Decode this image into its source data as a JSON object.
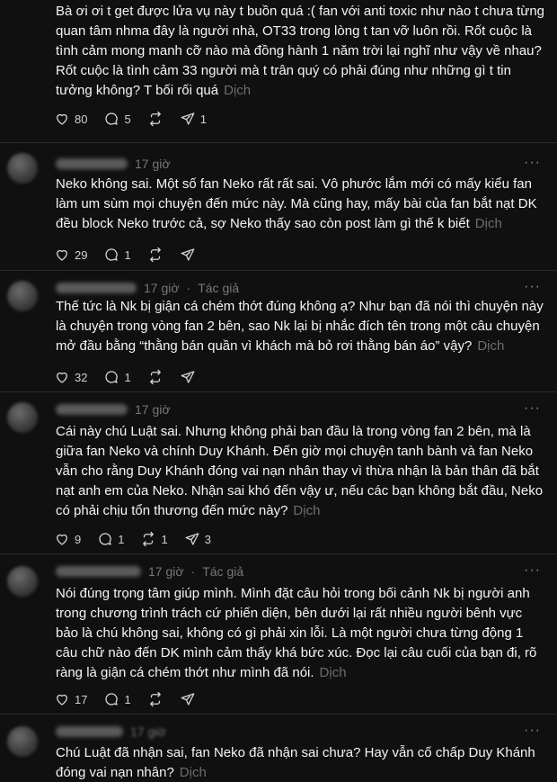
{
  "translate_label": "Dịch",
  "posts": [
    {
      "text": "Bà ơi ơi t get được lửa vụ này t buồn quá :( fan với anti toxic như nào t chưa từng quan tâm nhma đây là người nhà, OT33 trong lòng t tan vỡ luôn rồi. Rốt cuộc là tình cảm mong manh cỡ nào mà đồng hành 1 năm trời lại nghĩ như vậy về nhau? Rốt cuộc là tình cảm 33 người mà t trân quý có phải đúng như những gì t tin tưởng không? T bối rối quá",
      "likes": "80",
      "replies": "5",
      "reposts": "",
      "shares": "1"
    },
    {
      "time": "17 giờ",
      "author_tag": "",
      "text": "Neko không sai. Một số fan Neko rất rất sai. Vô phước lắm mới có mấy kiểu fan làm um sùm mọi chuyện đến mức này. Mà cũng hay, mấy bài của fan bắt nạt DK đều block Neko trước cả, sợ Neko thấy sao còn post làm gì thế k biết",
      "likes": "29",
      "replies": "1",
      "reposts": "",
      "shares": ""
    },
    {
      "time": "17 giờ",
      "author_tag": "Tác giả",
      "text": "Thế tức là Nk bị giận cá chém thớt đúng không ạ? Như bạn đã nói thì chuyện này là chuyện trong vòng fan 2 bên, sao Nk lại bị nhắc đích tên trong một câu chuyện mở đầu bằng “thằng bán quần vì khách mà bỏ rơi thằng bán áo” vậy?",
      "likes": "32",
      "replies": "1",
      "reposts": "",
      "shares": ""
    },
    {
      "time": "17 giờ",
      "author_tag": "",
      "text": "Cái này chú Luật sai. Nhưng không phải ban đầu là trong vòng fan 2 bên, mà là giữa fan Neko và chính Duy Khánh. Đến giờ mọi chuyện tanh bành và fan Neko vẫn cho rằng Duy Khánh đóng vai nạn nhân thay vì thừa nhận là bản thân đã bắt nạt anh em của Neko. Nhận sai khó đến vậy ư, nếu các bạn không bắt đầu, Neko có phải chịu tổn thương đến mức này?",
      "likes": "9",
      "replies": "1",
      "reposts": "1",
      "shares": "3"
    },
    {
      "time": "17 giờ",
      "author_tag": "Tác giả",
      "text": "Nói đúng trọng tâm giúp mình. Mình đặt câu hỏi trong bối cảnh Nk bị người anh trong chương trình trách cứ phiến diện, bên dưới lại rất nhiều người bênh vực bảo là chú không sai, không có gì phải xin lỗi. Là một người chưa từng động 1 câu chữ nào đến DK mình cảm thấy khá bức xúc. Đọc lại câu cuối của bạn đi, rõ ràng là giận cá chém thớt như mình đã nói.",
      "likes": "17",
      "replies": "1",
      "reposts": "",
      "shares": ""
    },
    {
      "time": "17 giờ",
      "author_tag": "",
      "text": "Chú Luật đã nhận sai, fan Neko đã nhận sai chưa? Hay vẫn cố chấp Duy Khánh đóng vai nạn nhân?",
      "likes": "",
      "replies": "",
      "reposts": "",
      "shares": ""
    }
  ]
}
